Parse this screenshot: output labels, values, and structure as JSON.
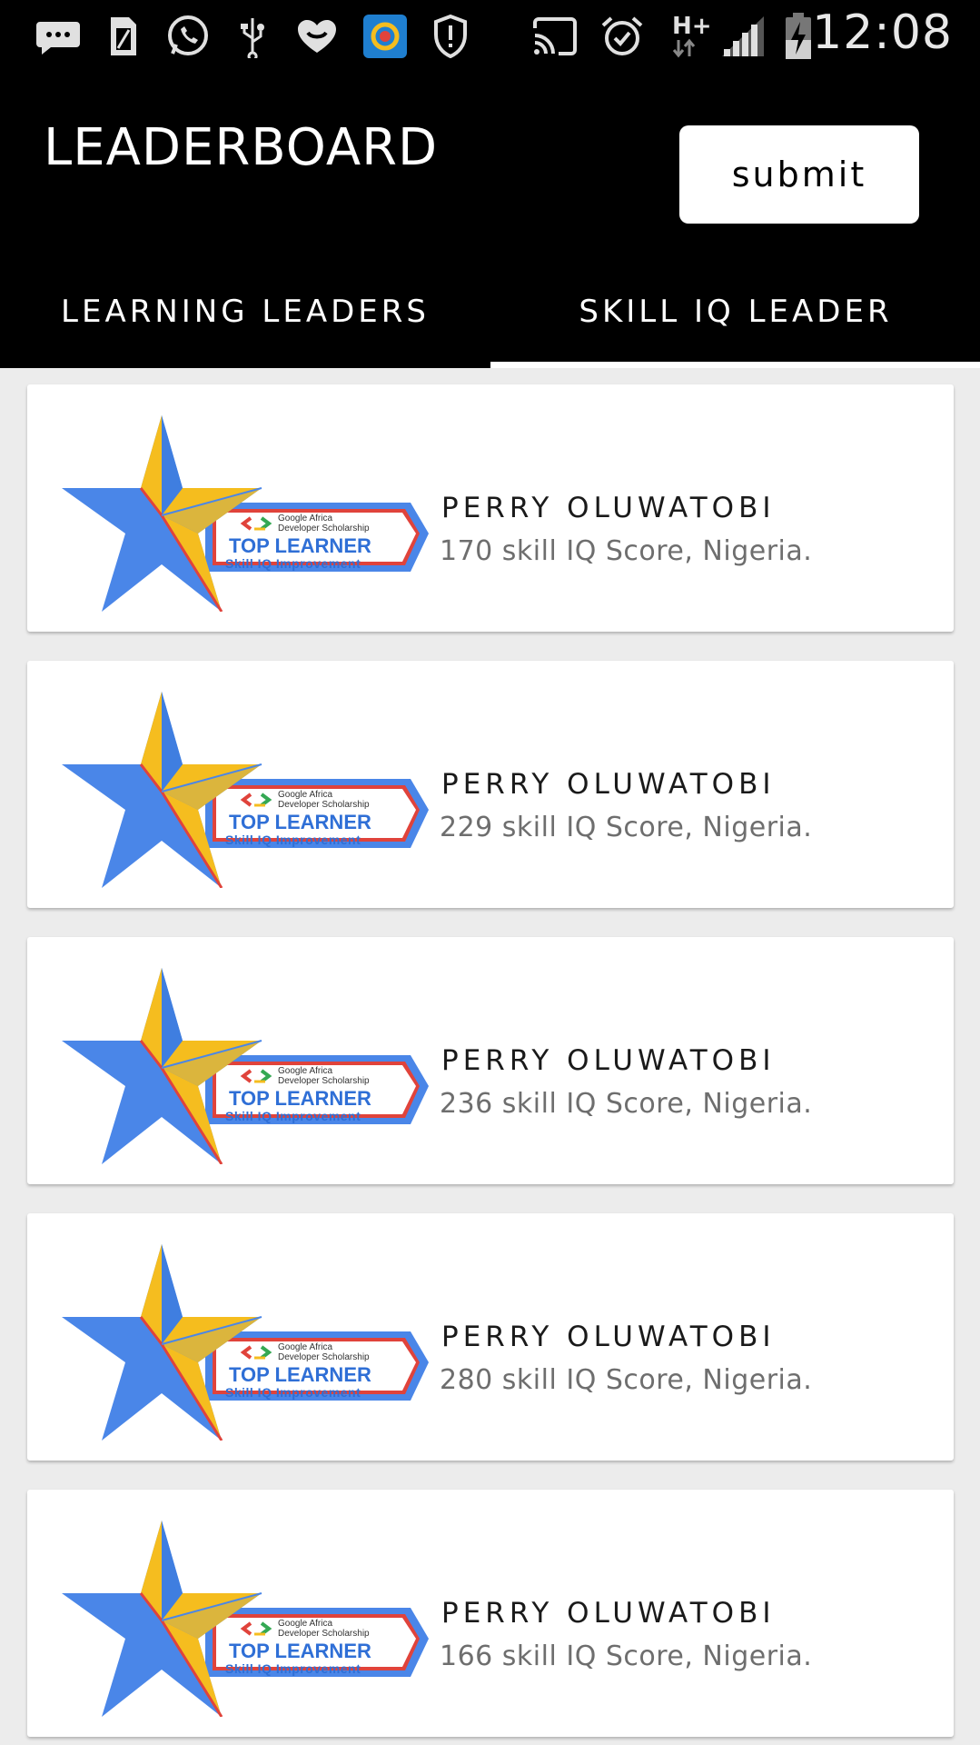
{
  "status_bar": {
    "time": "12:08",
    "network_label": "H+",
    "icons": [
      "message-icon",
      "sim-icon",
      "whatsapp-icon",
      "usb-icon",
      "heart-icon",
      "app-icon",
      "shield-icon",
      "cast-icon",
      "alarm-icon",
      "network-type-icon",
      "signal-icon",
      "battery-icon"
    ]
  },
  "header": {
    "title": "LEADERBOARD",
    "submit_label": "submit"
  },
  "tabs": [
    {
      "label": "LEARNING LEADERS",
      "selected": false
    },
    {
      "label": "SKILL IQ LEADER",
      "selected": true
    }
  ],
  "badge": {
    "brand_line1": "Google Africa",
    "brand_line2": "Developer Scholarship",
    "title": "TOP LEARNER",
    "subtitle": "Skill IQ Improvement"
  },
  "leaders": [
    {
      "name": "PERRY OLUWATOBI",
      "detail": "170 skill IQ Score, Nigeria."
    },
    {
      "name": "PERRY OLUWATOBI",
      "detail": "229 skill IQ Score, Nigeria."
    },
    {
      "name": "PERRY OLUWATOBI",
      "detail": "236 skill IQ Score, Nigeria."
    },
    {
      "name": "PERRY OLUWATOBI",
      "detail": "280 skill IQ Score, Nigeria."
    },
    {
      "name": "PERRY OLUWATOBI",
      "detail": "166 skill IQ Score, Nigeria."
    }
  ],
  "colors": {
    "appbar": "#000000",
    "star_blue": "#4a86e8",
    "star_gold": "#f5bd1f",
    "ribbon_red": "#e0433b"
  }
}
